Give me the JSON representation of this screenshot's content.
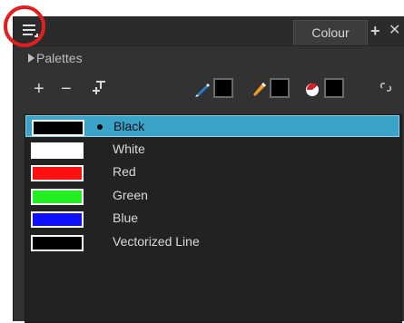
{
  "header": {
    "tab_label": "Colour",
    "add_icon": "plus-icon",
    "close_icon": "close-icon",
    "menu_icon": "hamburger-menu-icon"
  },
  "palettes": {
    "label": "Palettes"
  },
  "toolbar": {
    "add_label": "+",
    "remove_label": "−",
    "texture_label": "+"
  },
  "colors": {
    "accent_selected": "#3aa3c8",
    "highlight_circle": "#e02020"
  },
  "swatches": [
    {
      "name": "Black",
      "color": "#000000",
      "selected": true
    },
    {
      "name": "White",
      "color": "#ffffff",
      "selected": false
    },
    {
      "name": "Red",
      "color": "#ff1010",
      "selected": false
    },
    {
      "name": "Green",
      "color": "#22ee22",
      "selected": false
    },
    {
      "name": "Blue",
      "color": "#1010ff",
      "selected": false
    },
    {
      "name": "Vectorized Line",
      "color": "#000000",
      "selected": false
    }
  ]
}
